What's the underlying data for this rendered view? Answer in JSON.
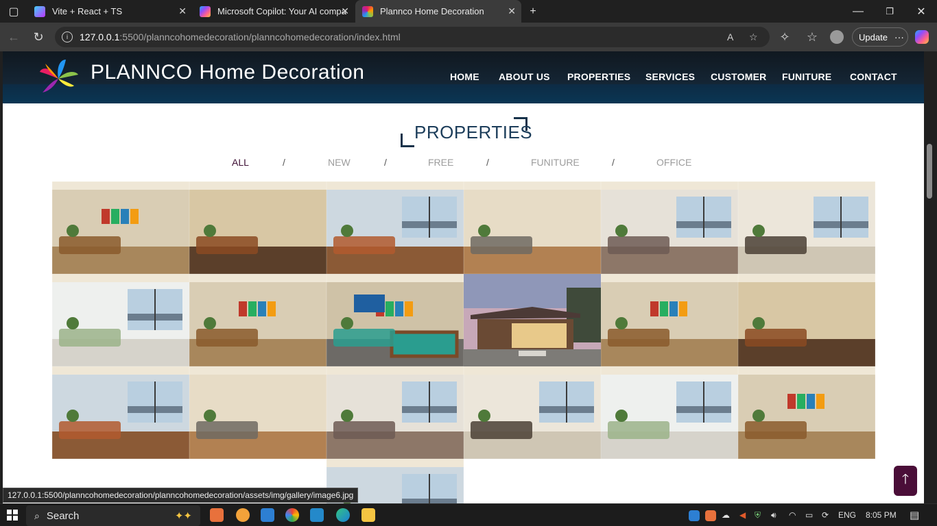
{
  "browser": {
    "tabs": [
      {
        "title": "Vite + React + TS",
        "icon": "vite-icon"
      },
      {
        "title": "Microsoft Copilot: Your AI compa",
        "icon": "copilot-icon"
      },
      {
        "title": "Plannco Home Decoration",
        "icon": "plannco-icon"
      }
    ],
    "url_host": "127.0.0.1",
    "url_path": ":5500/planncohomedecoration/planncohomedecoration/index.html",
    "update_label": "Update",
    "status_url": "127.0.0.1:5500/planncohomedecoration/planncohomedecoration/assets/img/gallery/image6.jpg"
  },
  "site": {
    "brand_main": "PLANNCO",
    "brand_sub": "Home Decoration",
    "nav": [
      "HOME",
      "ABOUT US",
      "PROPERTIES",
      "SERVICES",
      "CUSTOMER",
      "FUNITURE",
      "CONTACT"
    ],
    "section_title": "PROPERTIES",
    "filters": [
      "ALL",
      "NEW",
      "FREE",
      "FUNITURE",
      "OFFICE"
    ],
    "filter_separator": "/",
    "active_filter": "ALL",
    "colors": {
      "header": "#142534",
      "accent": "#3d0f34",
      "title": "#1c3d5a"
    }
  },
  "gallery": {
    "images": [
      "living-room",
      "kitchen-bar",
      "kitchen-window",
      "lounge-chairs",
      "bedroom-view",
      "bathroom-vanity",
      "white-living-room",
      "living-room",
      "billiard-room",
      "house-garage",
      "living-room",
      "kitchen-bar",
      "kitchen-window",
      "lounge-chairs",
      "bedroom-view",
      "bathroom-vanity",
      "white-living-room",
      "living-room",
      "kitchen-window"
    ]
  },
  "taskbar": {
    "search_label": "Search",
    "language": "ENG",
    "time": "8:05 PM"
  }
}
